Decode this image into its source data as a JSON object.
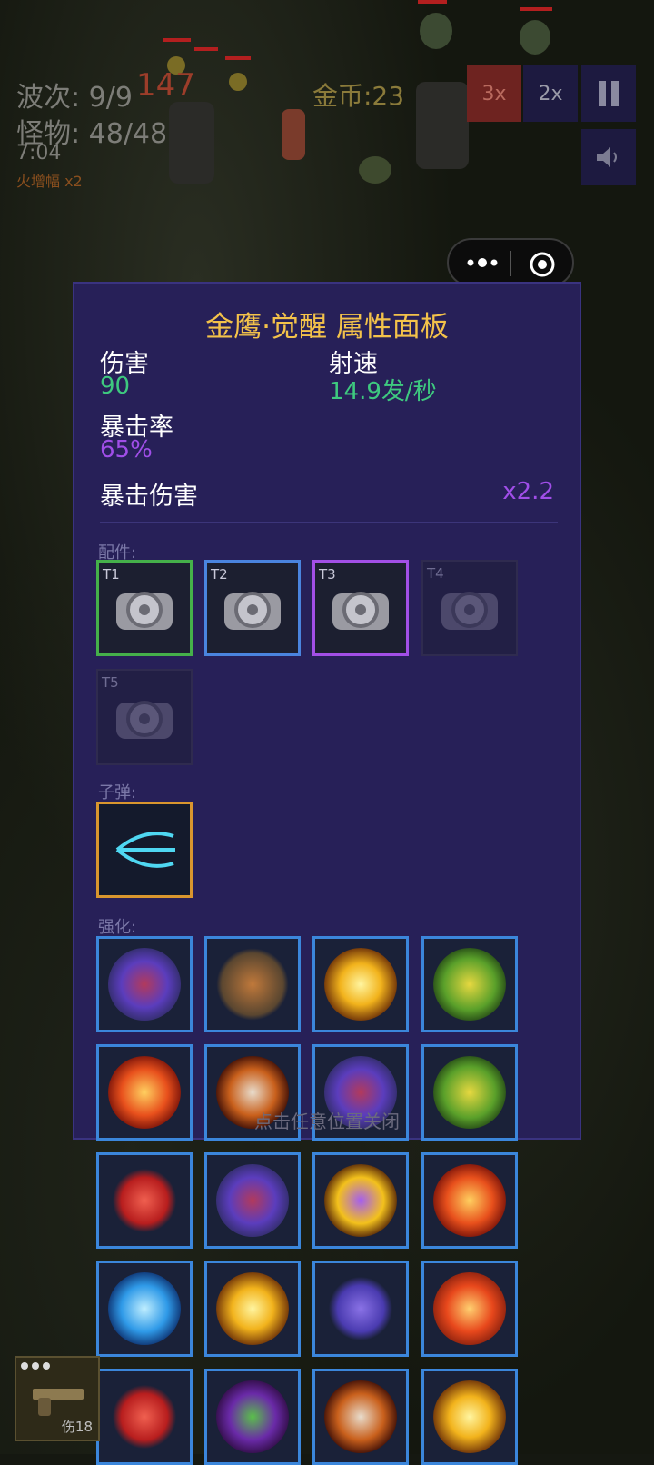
{
  "hud": {
    "wave": "波次: 9/9",
    "monsters": "怪物: 48/48",
    "timer": "7:04",
    "fire_boost": "火增幅 x2",
    "damage_float": "147",
    "gold": "金币:23"
  },
  "controls": {
    "speed3x": "3x",
    "speed2x": "2x",
    "pause_icon": "pause-icon",
    "sound_icon": "speaker-icon",
    "accent_3x": "#b8312e",
    "accent_2x": "#1f1a4d"
  },
  "panel": {
    "title": "金鹰·觉醒 属性面板",
    "damage_label": "伤害",
    "damage_value": "90",
    "rate_label": "射速",
    "rate_value": "14.9发/秒",
    "crit_rate_label": "暴击率",
    "crit_rate_value": "65%",
    "crit_dmg_label": "暴击伤害",
    "crit_dmg_value": "x2.2",
    "parts_label": "配件:",
    "parts": [
      "T1",
      "T2",
      "T3",
      "T4",
      "T5"
    ],
    "bullet_label": "子弹:",
    "enhance_label": "强化:",
    "close_hint": "点击任意位置关闭",
    "bg_color": "#272058",
    "title_color": "#f3c24a",
    "green_color": "#3ec97f",
    "purple_color": "#a04ee8"
  },
  "enhancements": [
    "skull-vortex-icon",
    "miner-icon",
    "explosion-star-icon",
    "money-tree-icon",
    "fireball-icon",
    "flaming-skull-icon",
    "skull-vortex-icon",
    "money-tree-icon",
    "fist-arrow-icon",
    "skull-vortex-icon",
    "arrow-burst-icon",
    "fireball-icon",
    "water-orb-icon",
    "explosion-star-icon",
    "clone-figures-icon",
    "fire-punch-icon",
    "fist-arrow-icon",
    "zombie-portal-icon",
    "flaming-skull-icon",
    "explosion-star-icon"
  ],
  "weapon": {
    "label": "伤18",
    "icon": "pistol-icon"
  }
}
